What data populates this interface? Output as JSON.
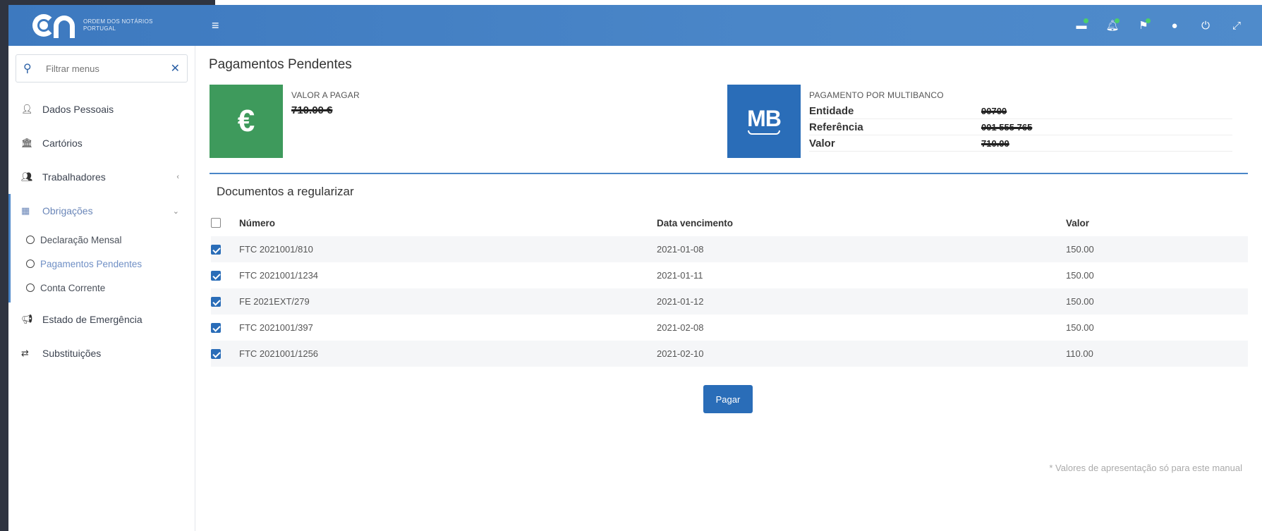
{
  "app": {
    "logo_text_line1": "ORDEM DOS NOTÁRIOS",
    "logo_text_line2": "PORTUGAL",
    "menu_icon": "hamburger-icon"
  },
  "header": {
    "icons": [
      {
        "name": "messages-icon",
        "badge": true
      },
      {
        "name": "bell-icon",
        "badge": true
      },
      {
        "name": "flag-icon",
        "badge": true
      },
      {
        "name": "user-icon",
        "badge": false
      },
      {
        "name": "power-icon",
        "badge": false
      },
      {
        "name": "expand-icon",
        "badge": false
      }
    ],
    "badge_color": "#4ccf6a",
    "bar_color": "#4a86c8"
  },
  "sidebar": {
    "search_placeholder": "Filtrar menus",
    "items": [
      {
        "label": "Dados Pessoais",
        "icon": "user-icon"
      },
      {
        "label": "Cartórios",
        "icon": "bank-icon"
      },
      {
        "label": "Trabalhadores",
        "icon": "users-icon"
      },
      {
        "label": "Obrigações",
        "icon": "calculator-icon"
      },
      {
        "label": "Estado de Emergência",
        "icon": "megaphone-icon"
      },
      {
        "label": "Substituições",
        "icon": "exchange-icon"
      }
    ],
    "subitems": [
      {
        "label": "Declaração Mensal"
      },
      {
        "label": "Pagamentos Pendentes"
      },
      {
        "label": "Conta Corrente"
      }
    ]
  },
  "main": {
    "title": "Pagamentos Pendentes",
    "amount_card": {
      "label": "VALOR A PAGAR",
      "value": "710.00 €",
      "icon": "euro-icon",
      "color": "#3e9a5c"
    },
    "multibanco_card": {
      "label": "PAGAMENTO POR MULTIBANCO",
      "icon_text": "MB",
      "color": "#2a6db8",
      "rows": [
        {
          "key": "Entidade",
          "value": "90700"
        },
        {
          "key": "Referência",
          "value": "001 555 765"
        },
        {
          "key": "Valor",
          "value": "710.00"
        }
      ]
    },
    "documents_title": "Documentos a regularizar",
    "table": {
      "headers": {
        "number": "Número",
        "due_date": "Data vencimento",
        "value": "Valor"
      },
      "rows": [
        {
          "number": "FTC 2021001/810",
          "due_date": "2021-01-08",
          "value": "150.00",
          "checked": true
        },
        {
          "number": "FTC 2021001/1234",
          "due_date": "2021-01-11",
          "value": "150.00",
          "checked": true
        },
        {
          "number": "FE 2021EXT/279",
          "due_date": "2021-01-12",
          "value": "150.00",
          "checked": true
        },
        {
          "number": "FTC 2021001/397",
          "due_date": "2021-02-08",
          "value": "150.00",
          "checked": true
        },
        {
          "number": "FTC 2021001/1256",
          "due_date": "2021-02-10",
          "value": "110.00",
          "checked": true
        }
      ]
    },
    "pay_button": "Pagar",
    "footnote": "* Valores de apresentação só para este manual"
  }
}
